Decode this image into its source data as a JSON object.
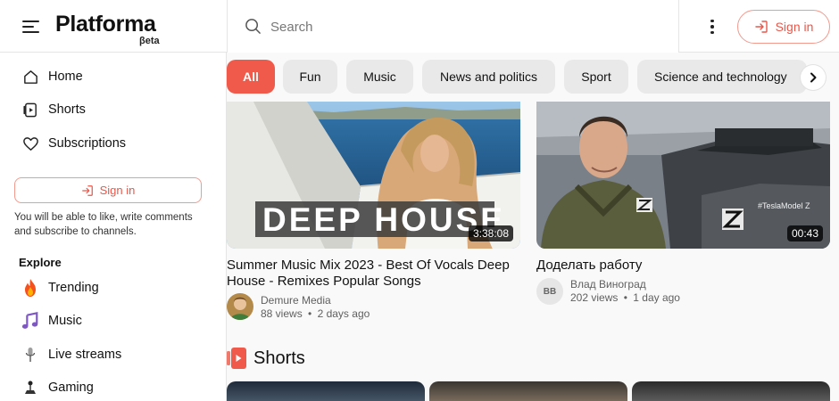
{
  "header": {
    "logo": "Platforma",
    "logo_badge": "βeta",
    "search_placeholder": "Search",
    "signin_label": "Sign in"
  },
  "sidebar": {
    "nav": [
      {
        "label": "Home",
        "icon": "home-icon"
      },
      {
        "label": "Shorts",
        "icon": "shorts-icon"
      },
      {
        "label": "Subscriptions",
        "icon": "heart-icon"
      }
    ],
    "signin_label": "Sign in",
    "signin_note": "You will be able to like, write comments and subscribe to channels.",
    "explore_title": "Explore",
    "explore": [
      {
        "label": "Trending",
        "icon": "fire-icon"
      },
      {
        "label": "Music",
        "icon": "music-note-icon"
      },
      {
        "label": "Live streams",
        "icon": "microphone-icon"
      },
      {
        "label": "Gaming",
        "icon": "joystick-icon"
      }
    ]
  },
  "chips": [
    "All",
    "Fun",
    "Music",
    "News and politics",
    "Sport",
    "Science and technology"
  ],
  "videos": [
    {
      "title": "Summer Music Mix 2023 - Best Of Vocals Deep House - Remixes Popular Songs",
      "thumb_text": "DEEP HOUSE",
      "duration": "3:38:08",
      "channel": "Demure Media",
      "views": "88 views",
      "age": "2 days ago"
    },
    {
      "title": "Доделать работу",
      "thumb_text": "#TeslaModel Z",
      "duration": "00:43",
      "channel": "Влад Виноград",
      "avatar_initials": "ВВ",
      "views": "202 views",
      "age": "1 day ago"
    }
  ],
  "shorts": {
    "title": "Shorts"
  },
  "colors": {
    "accent": "#ef5a4b",
    "chip_bg": "#e9e9e9",
    "page_bg": "#f9f9f9"
  }
}
